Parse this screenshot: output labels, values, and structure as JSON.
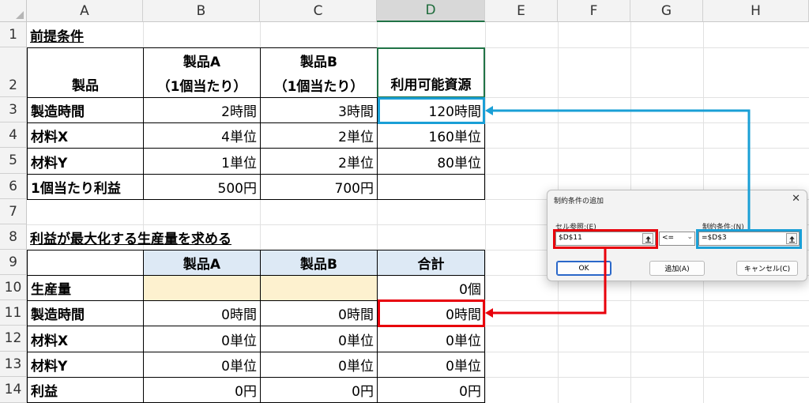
{
  "columns": [
    "A",
    "B",
    "C",
    "D",
    "E",
    "F",
    "G",
    "H"
  ],
  "rows": [
    "1",
    "2",
    "3",
    "4",
    "5",
    "6",
    "7",
    "8",
    "9",
    "10",
    "11",
    "12",
    "13",
    "14"
  ],
  "sheet": {
    "a1": "前提条件",
    "a2": "製品",
    "b2_line1": "製品A",
    "b2_line2": "（1個当たり）",
    "c2_line1": "製品B",
    "c2_line2": "（1個当たり）",
    "d2": "利用可能資源",
    "a3": "製造時間",
    "b3": "2時間",
    "c3": "3時間",
    "d3": "120時間",
    "a4": "材料X",
    "b4": "4単位",
    "c4": "2単位",
    "d4": "160単位",
    "a5": "材料Y",
    "b5": "1単位",
    "c5": "2単位",
    "d5": "80単位",
    "a6": "1個当たり利益",
    "b6": "500円",
    "c6": "700円",
    "a8": "利益が最大化する生産量を求める",
    "b9": "製品A",
    "c9": "製品B",
    "d9": "合計",
    "a10": "生産量",
    "d10": "0個",
    "a11": "製造時間",
    "b11": "0時間",
    "c11": "0時間",
    "d11": "0時間",
    "a12": "材料X",
    "b12": "0単位",
    "c12": "0単位",
    "d12": "0単位",
    "a13": "材料Y",
    "b13": "0単位",
    "c13": "0単位",
    "d13": "0単位",
    "a14": "利益",
    "b14": "0円",
    "c14": "0円",
    "d14": "0円"
  },
  "dialog": {
    "title": "制約条件の追加",
    "close": "✕",
    "cell_ref_label": "セル参照:(E)",
    "cell_ref_value": "$D$11",
    "operator": "<=",
    "constraint_label": "制約条件:(N)",
    "constraint_value": "=$D$3",
    "ok_label": "OK",
    "add_label": "追加(A)",
    "cancel_label": "キャンセル(C)"
  },
  "colors": {
    "accent_red": "#e8000b",
    "accent_blue": "#1a9fd6",
    "header_fill": "#dde9f5",
    "input_fill": "#fdf1cf",
    "active_column": "#217346"
  }
}
